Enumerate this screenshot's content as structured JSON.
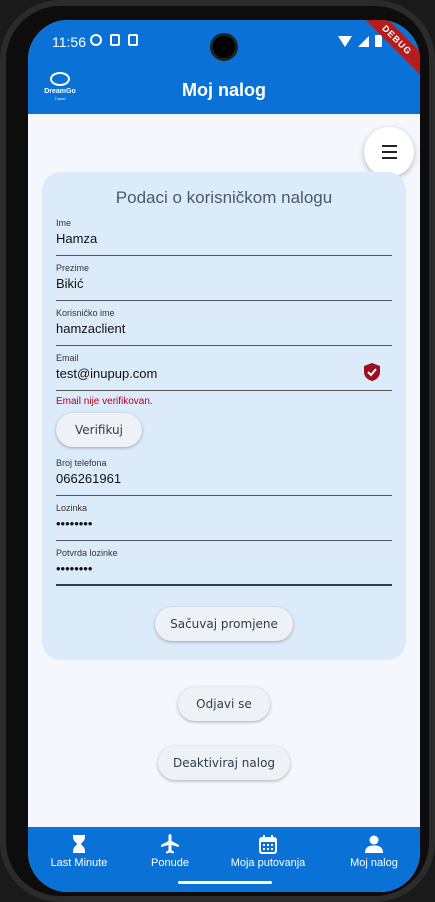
{
  "status": {
    "time": "11:56"
  },
  "debug_label": "DEBUG",
  "app": {
    "logo_text": "DreamGo",
    "logo_sub": "Travel",
    "title": "Moj nalog"
  },
  "card": {
    "title": "Podaci o korisničkom nalogu",
    "fields": [
      {
        "label": "Ime",
        "value": "Hamza"
      },
      {
        "label": "Prezime",
        "value": "Bikić"
      },
      {
        "label": "Korisničko ime",
        "value": "hamzaclient"
      },
      {
        "label": "Email",
        "value": "test@inupup.com"
      },
      {
        "label": "Broj telefona",
        "value": "066261961"
      },
      {
        "label": "Lozinka",
        "value": "••••••••"
      },
      {
        "label": "Potvrda lozinke",
        "value": "••••••••"
      }
    ],
    "email_error": "Email nije verifikovan.",
    "verify_label": "Verifikuj",
    "save_label": "Sačuvaj promjene"
  },
  "logout_label": "Odjavi se",
  "deactivate_label": "Deaktiviraj nalog",
  "bottom_nav": [
    {
      "label": "Last Minute",
      "icon": "hourglass-icon"
    },
    {
      "label": "Ponude",
      "icon": "airplane-icon"
    },
    {
      "label": "Moja putovanja",
      "icon": "calendar-icon"
    },
    {
      "label": "Moj nalog",
      "icon": "person-icon"
    }
  ],
  "colors": {
    "primary": "#0a72d6",
    "card_bg": "#dcebfa",
    "error": "#b00020",
    "verified_shield": "#9b0f1e"
  }
}
